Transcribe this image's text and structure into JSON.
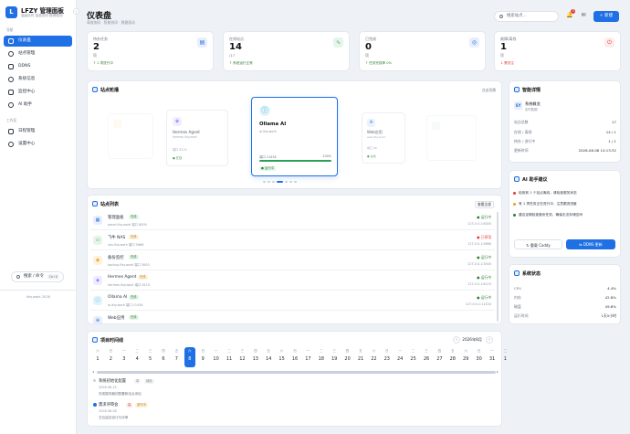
{
  "brand": {
    "logo": "L",
    "name": "LFZY 管理面板",
    "sub": "高级协同 智能协同 稳健驱动"
  },
  "sidebar": {
    "section1": "导航",
    "items": [
      {
        "label": "仪表盘",
        "icon": "dashboard-icon"
      },
      {
        "label": "站点管理",
        "icon": "globe-icon"
      },
      {
        "label": "DDNS",
        "icon": "swap-icon"
      },
      {
        "label": "系统信息",
        "icon": "info-icon"
      },
      {
        "label": "监控中心",
        "icon": "monitor-icon"
      },
      {
        "label": "AI 助手",
        "icon": "sparkle-icon"
      }
    ],
    "section2": "工作区",
    "items2": [
      {
        "label": "日程管理",
        "icon": "calendar-icon"
      },
      {
        "label": "设置中心",
        "icon": "gear-icon"
      }
    ],
    "search": "搜索 / 命令",
    "search_kbd": "Ctrl K",
    "footer": "lfzy.work 2026"
  },
  "header": {
    "title": "仪表盘",
    "subtitle": "高效协同 · 智能协同 · 稳健驱动",
    "search_placeholder": "搜索站点...",
    "badge": "3",
    "new_button": "新建"
  },
  "stats": [
    {
      "label": "待办任务",
      "value": "2",
      "unit": "项",
      "trend": "↑ 1 项进行中",
      "trend_color": "#2e7d32"
    },
    {
      "label": "在线站点",
      "value": "14",
      "unit": "/17",
      "trend": "↑ 系统运行正常",
      "trend_color": "#2e7d32"
    },
    {
      "label": "已完成",
      "value": "0",
      "unit": "项",
      "trend": "↑ 任务完成率 0%",
      "trend_color": "#2e7d32"
    },
    {
      "label": "故障/离线",
      "value": "1",
      "unit": "项",
      "trend": "↓ 需关注",
      "trend_color": "#e53935"
    }
  ],
  "carousel": {
    "title": "站点轮播",
    "action": "点击切换",
    "cards": [
      {
        "name": "Hermes Agent",
        "url": "hermes.lfzy.work",
        "port": "端口 8119",
        "status": "● 在线"
      },
      {
        "name": "Ollama AI",
        "url": "ai.lfzy.work",
        "port": "端口 11434",
        "pct": "100%",
        "status": "● 运行中"
      },
      {
        "name": "Web应用",
        "url": "web.lfzy.work",
        "port": "端口 80",
        "status": "● 在线"
      }
    ]
  },
  "sites": {
    "title": "站点列表",
    "action": "查看全部",
    "rows": [
      {
        "name": "管理面板",
        "tag": "在线",
        "detail": "panel.lfzy.work  端口 8000",
        "status": "● 运行中",
        "ip": "127.0.0.1:8000",
        "color": "#1f6fe5"
      },
      {
        "name": "飞牛 NAS",
        "tag": "在线",
        "detail": "nas.lfzy.work  端口 5666",
        "status": "● 已停用",
        "ip": "127.0.0.1:5666",
        "color": "#2e9d5a"
      },
      {
        "name": "备份监控",
        "tag": "在线",
        "detail": "backup.lfzy.work  端口 3000",
        "status": "● 运行中",
        "ip": "127.0.0.1:3000",
        "color": "#e8a317"
      },
      {
        "name": "Hermes Agent",
        "tag": "在线",
        "detail": "hermes.lfzy.work  端口 8119",
        "status": "● 运行中",
        "ip": "127.0.0.1:8119",
        "color": "#7b61ff"
      },
      {
        "name": "Ollama AI",
        "tag": "在线",
        "detail": "ai.lfzy.work  端口 11434",
        "status": "● 运行中",
        "ip": "127.0.0.1:11434",
        "color": "#1f9bd1"
      },
      {
        "name": "Web应用",
        "tag": "在线",
        "detail": "",
        "status": "",
        "ip": "",
        "color": "#1f6fe5"
      }
    ]
  },
  "detail": {
    "title": "智能详情",
    "name": "系统概览",
    "sub": "实时数据",
    "rows": [
      {
        "k": "站点总数",
        "v": "17"
      },
      {
        "k": "在线 / 离线",
        "v": "14  /  1"
      },
      {
        "k": "待办 / 进行中",
        "v": "1 / 1"
      },
      {
        "k": "更新时间",
        "v": "2026-08-08 14:13:32"
      }
    ]
  },
  "ai": {
    "title": "AI 助手建议",
    "items": [
      {
        "t": "检测到 1 个站点离线，请检查服务状态",
        "c": "#e53935"
      },
      {
        "t": "有 1 项任务正在进行中，注意跟进进度",
        "c": "#e8a317"
      },
      {
        "t": "建议定期检查备份任务，确保无法存储空间",
        "c": "#2e7d32"
      }
    ],
    "btn1": "重载 Caddy",
    "btn2": "DDNS 更新"
  },
  "sys": {
    "title": "系统状态",
    "rows": [
      {
        "k": "CPU",
        "v": "4.4%"
      },
      {
        "k": "内存",
        "v": "42.8%"
      },
      {
        "k": "磁盘",
        "v": "49.8%"
      },
      {
        "k": "运行时间",
        "v": "1天5小时"
      }
    ]
  },
  "timeline": {
    "title": "项目时间线",
    "month": "2026年8月",
    "weekdays": [
      "六",
      "日",
      "一",
      "二",
      "三",
      "四",
      "五",
      "六",
      "日",
      "一",
      "二",
      "三",
      "四",
      "五",
      "六",
      "日",
      "一",
      "二",
      "三",
      "四",
      "五",
      "六",
      "日",
      "一",
      "二",
      "三",
      "四",
      "五",
      "六",
      "日",
      "一",
      "二"
    ],
    "days": [
      "1",
      "2",
      "3",
      "4",
      "5",
      "6",
      "7",
      "8",
      "9",
      "10",
      "11",
      "12",
      "13",
      "14",
      "15",
      "16",
      "17",
      "18",
      "19",
      "20",
      "21",
      "22",
      "23",
      "24",
      "25",
      "26",
      "27",
      "28",
      "29",
      "30",
      "31",
      "1"
    ],
    "today_index": 7,
    "events": [
      {
        "title": "系统初始化配置",
        "tag1": "中",
        "tag2": "待办",
        "date": "2026-08-15",
        "note": "完成服务器初配置和站点添加"
      },
      {
        "title": "需求评审会",
        "tag1": "高",
        "tag2": "进行中",
        "date": "2026-08-28",
        "note": "交互监控设计与评审"
      }
    ]
  }
}
